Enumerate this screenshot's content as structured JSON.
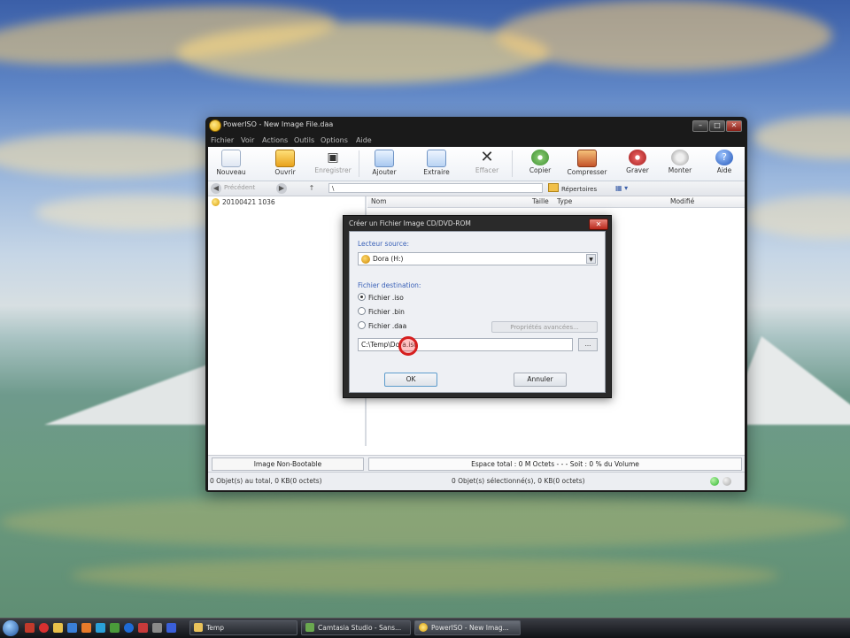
{
  "window": {
    "title": "PowerISO - New Image File.daa",
    "buttons": {
      "minimize": "–",
      "maximize": "□",
      "close": "✕"
    }
  },
  "menu": [
    "Fichier",
    "Voir",
    "Actions",
    "Outils",
    "Options",
    "Aide"
  ],
  "toolbar": {
    "nouveau": "Nouveau",
    "ouvrir": "Ouvrir",
    "enregistrer": "Enregistrer",
    "ajouter": "Ajouter",
    "extraire": "Extraire",
    "effacer": "Effacer",
    "copier": "Copier",
    "compresser": "Compresser",
    "graver": "Graver",
    "monter": "Monter",
    "aide": "Aide"
  },
  "address": {
    "back_label": "Précédent",
    "path": "\\",
    "repertoires": "Répertoires"
  },
  "tree": {
    "root": "20100421 1036"
  },
  "list": {
    "columns": [
      "Nom",
      "Taille",
      "Type",
      "Modifié"
    ]
  },
  "status": {
    "boot": "Image Non-Bootable",
    "space": "Espace total : 0 M Octets - - - Soit : 0 % du Volume",
    "objects_total": "0 Objet(s) au total, 0 KB(0 octets)",
    "objects_selected": "0 Objet(s) sélectionné(s), 0 KB(0 octets)"
  },
  "dialog": {
    "title": "Créer un Fichier Image CD/DVD-ROM",
    "close": "✕",
    "source_label": "Lecteur source:",
    "source_value": "Dora (H:)",
    "dest_label": "Fichier destination:",
    "radios": [
      {
        "label": "Fichier .iso",
        "checked": true
      },
      {
        "label": "Fichier .bin",
        "checked": false
      },
      {
        "label": "Fichier .daa",
        "checked": false
      }
    ],
    "props_button": "Propriétés avancées...",
    "dest_path": "C:\\Temp\\Dora.iso",
    "browse": "...",
    "ok": "OK",
    "cancel": "Annuler"
  },
  "taskbar": {
    "tasks": [
      "Temp",
      "Camtasia Studio - Sans...",
      "PowerISO - New Imag..."
    ]
  },
  "colors": {
    "section_label": "#3b62b8",
    "led_green": "#2fb52f",
    "led_gray": "#b7b7b7",
    "dialog_close": "#c0392b"
  }
}
